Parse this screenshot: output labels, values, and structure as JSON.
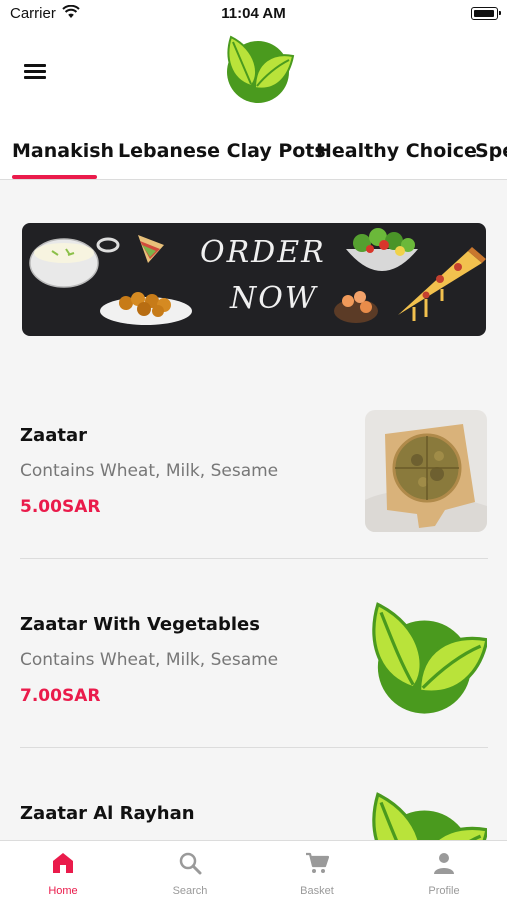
{
  "status_bar": {
    "carrier": "Carrier",
    "time": "11:04 AM"
  },
  "colors": {
    "accent": "#ea1b4b",
    "logo_dark": "#4a9a1e",
    "logo_light": "#b9e33a"
  },
  "tabs": [
    {
      "label": "Manakish",
      "active": true
    },
    {
      "label": "Lebanese Clay Pots",
      "active": false
    },
    {
      "label": "Healthy Choice",
      "active": false
    },
    {
      "label": "Spe",
      "active": false
    }
  ],
  "banner": {
    "line1": "ORDER",
    "line2": "NOW"
  },
  "items": [
    {
      "name": "Zaatar",
      "description": "Contains Wheat, Milk, Sesame",
      "price": "5.00SAR",
      "image": "manakish-photo"
    },
    {
      "name": "Zaatar With Vegetables",
      "description": "Contains Wheat, Milk, Sesame",
      "price": "7.00SAR",
      "image": "leaf-logo"
    },
    {
      "name": "Zaatar Al Rayhan",
      "description": "",
      "price": "",
      "image": "leaf-logo"
    }
  ],
  "bottom_nav": [
    {
      "label": "Home",
      "icon": "home-icon",
      "active": true
    },
    {
      "label": "Search",
      "icon": "search-icon",
      "active": false
    },
    {
      "label": "Basket",
      "icon": "cart-icon",
      "active": false
    },
    {
      "label": "Profile",
      "icon": "person-icon",
      "active": false
    }
  ]
}
